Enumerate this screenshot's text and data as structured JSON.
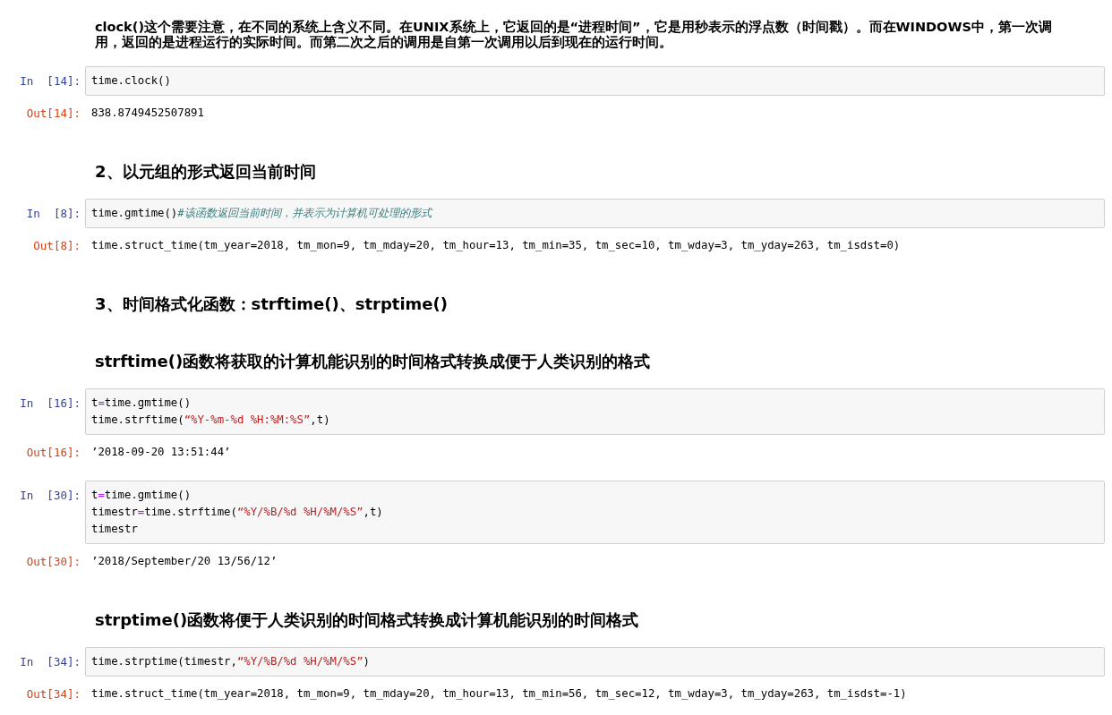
{
  "cells": [
    {
      "kind": "paragraph",
      "text": "clock()这个需要注意，在不同的系统上含义不同。在UNIX系统上，它返回的是“进程时间”，它是用秒表示的浮点数（时间戳）。而在WINDOWS中，第一次调用，返回的是进程运行的实际时间。而第二次之后的调用是自第一次调用以后到现在的运行时间。"
    },
    {
      "kind": "input",
      "prompt": "In  [14]:",
      "lines": [
        [
          {
            "kind": "name",
            "text": "time.clock()"
          }
        ]
      ]
    },
    {
      "kind": "output",
      "prompt": "Out[14]:",
      "text": "838.8749452507891"
    },
    {
      "kind": "heading",
      "text": "2、以元组的形式返回当前时间"
    },
    {
      "kind": "input",
      "prompt": "In  [8]:",
      "lines": [
        [
          {
            "kind": "name",
            "text": "time.gmtime()"
          },
          {
            "kind": "comment",
            "text": "#该函数返回当前时间，并表示为计算机可处理的形式"
          }
        ]
      ]
    },
    {
      "kind": "output",
      "prompt": "Out[8]:",
      "text": "time.struct_time(tm_year=2018, tm_mon=9, tm_mday=20, tm_hour=13, tm_min=35, tm_sec=10, tm_wday=3, tm_yday=263, tm_isdst=0)"
    },
    {
      "kind": "heading",
      "text": "3、时间格式化函数：strftime()、strptime()"
    },
    {
      "kind": "heading",
      "text": "strftime()函数将获取的计算机能识别的时间格式转换成便于人类识别的格式"
    },
    {
      "kind": "input",
      "prompt": "In  [16]:",
      "lines": [
        [
          {
            "kind": "name",
            "text": "t"
          },
          {
            "kind": "op",
            "text": "="
          },
          {
            "kind": "name",
            "text": "time.gmtime()"
          }
        ],
        [
          {
            "kind": "name",
            "text": "time.strftime("
          },
          {
            "kind": "string",
            "text": "“%Y-%m-%d %H:%M:%S”"
          },
          {
            "kind": "name",
            "text": ",t)"
          }
        ]
      ]
    },
    {
      "kind": "output",
      "prompt": "Out[16]:",
      "text": "’2018-09-20 13:51:44’"
    },
    {
      "kind": "input",
      "prompt": "In  [30]:",
      "lines": [
        [
          {
            "kind": "name",
            "text": "t"
          },
          {
            "kind": "op",
            "text": "="
          },
          {
            "kind": "name",
            "text": "time.gmtime()"
          }
        ],
        [
          {
            "kind": "name",
            "text": "timestr"
          },
          {
            "kind": "op",
            "text": "="
          },
          {
            "kind": "name",
            "text": "time.strftime("
          },
          {
            "kind": "string",
            "text": "“%Y/%B/%d %H/%M/%S”"
          },
          {
            "kind": "name",
            "text": ",t)"
          }
        ],
        [
          {
            "kind": "name",
            "text": "timestr"
          }
        ]
      ]
    },
    {
      "kind": "output",
      "prompt": "Out[30]:",
      "text": "’2018/September/20 13/56/12’"
    },
    {
      "kind": "heading",
      "text": "strptime()函数将便于人类识别的时间格式转换成计算机能识别的时间格式"
    },
    {
      "kind": "input",
      "prompt": "In  [34]:",
      "lines": [
        [
          {
            "kind": "name",
            "text": "time.strptime(timestr,"
          },
          {
            "kind": "string",
            "text": "“%Y/%B/%d %H/%M/%S”"
          },
          {
            "kind": "name",
            "text": ")"
          }
        ]
      ]
    },
    {
      "kind": "output",
      "prompt": "Out[34]:",
      "text": "time.struct_time(tm_year=2018, tm_mon=9, tm_mday=20, tm_hour=13, tm_min=56, tm_sec=12, tm_wday=3, tm_yday=263, tm_isdst=-1)"
    }
  ]
}
